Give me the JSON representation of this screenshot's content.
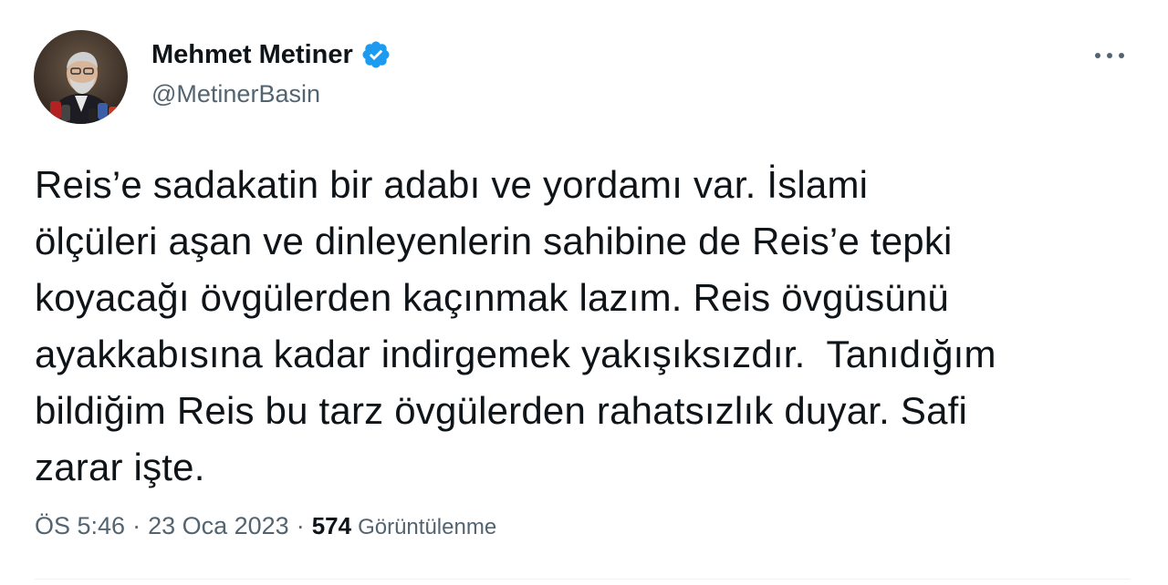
{
  "author": {
    "display_name": "Mehmet Metiner",
    "handle": "@MetinerBasin",
    "verified": true
  },
  "tweet": {
    "text": "Reis’e sadakatin bir adabı ve yordamı var. İslami\nölçüleri aşan ve dinleyenlerin sahibine de Reis’e tepki\nkoyacağı övgülerden kaçınmak lazım. Reis övgüsünü\nayakkabısına kadar indirgemek yakışıksızdır.  Tanıdığım\nbildiğim Reis bu tarz övgülerden rahatsızlık duyar. Safi\nzarar işte."
  },
  "meta": {
    "time": "ÖS 5:46",
    "separator": "·",
    "date": "23 Oca 2023",
    "views_count": "574",
    "views_label": "Görüntülenme"
  },
  "icons": {
    "verified": "verified-badge-icon",
    "more": "more-options-icon"
  },
  "colors": {
    "accent": "#1d9bf0",
    "text": "#0f1419",
    "secondary": "#536471"
  }
}
